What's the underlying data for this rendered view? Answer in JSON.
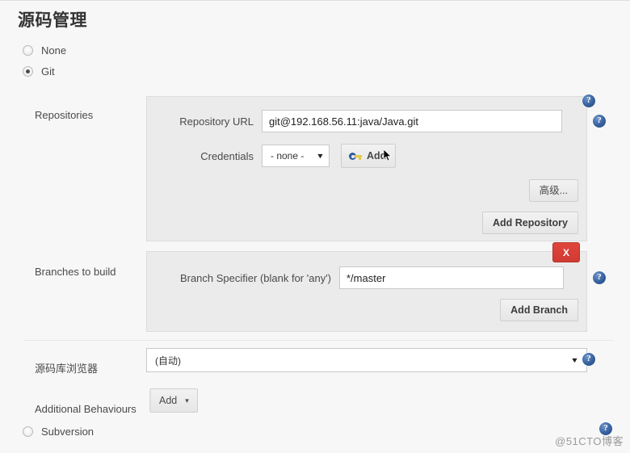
{
  "page": {
    "title": "源码管理",
    "watermark": "@51CTO博客"
  },
  "scm_options": [
    {
      "label": "None",
      "selected": false
    },
    {
      "label": "Git",
      "selected": true
    },
    {
      "label": "Subversion",
      "selected": false
    }
  ],
  "git": {
    "repositories": {
      "label": "Repositories",
      "repository_url": {
        "label": "Repository URL",
        "value": "git@192.168.56.11:java/Java.git"
      },
      "credentials": {
        "label": "Credentials",
        "selected": "- none -",
        "caret": "▼",
        "add_button": "Add",
        "add_icon": "key-icon"
      },
      "advanced_button": "高级...",
      "add_repository_button": "Add Repository"
    },
    "branches": {
      "label": "Branches to build",
      "branch_specifier": {
        "label": "Branch Specifier (blank for 'any')",
        "value": "*/master"
      },
      "delete_button": "X",
      "add_branch_button": "Add Branch"
    },
    "repository_browser": {
      "label": "源码库浏览器",
      "selected": "(自动)",
      "caret": "▼"
    },
    "additional_behaviours": {
      "label": "Additional Behaviours",
      "add_button": "Add",
      "caret": "▾"
    }
  },
  "help_icon_glyph": "?",
  "colors": {
    "page_background": "#f7f7f7",
    "panel_background": "#ebebeb",
    "help_blue": "#35619f",
    "delete_red": "#d0392f",
    "text": "#4a4a4a"
  }
}
